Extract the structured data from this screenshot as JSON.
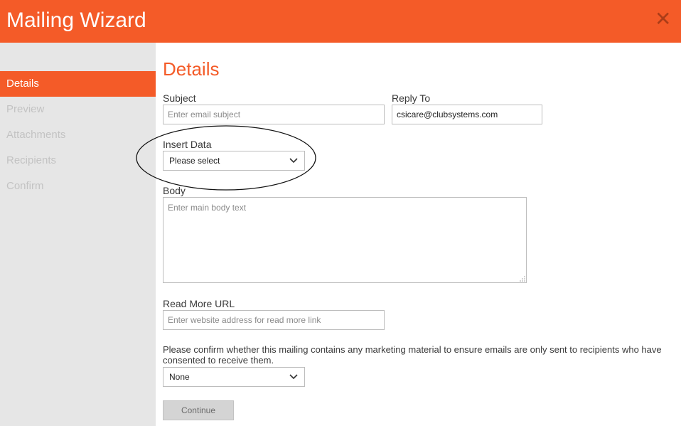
{
  "header": {
    "title": "Mailing Wizard",
    "close_icon": "close-icon"
  },
  "sidebar": {
    "items": [
      {
        "label": "Details",
        "active": true
      },
      {
        "label": "Preview",
        "active": false
      },
      {
        "label": "Attachments",
        "active": false
      },
      {
        "label": "Recipients",
        "active": false
      },
      {
        "label": "Confirm",
        "active": false
      }
    ]
  },
  "main": {
    "title": "Details",
    "subject": {
      "label": "Subject",
      "placeholder": "Enter email subject",
      "value": ""
    },
    "reply_to": {
      "label": "Reply To",
      "value": "csicare@clubsystems.com"
    },
    "insert_data": {
      "label": "Insert Data",
      "selected": "Please select"
    },
    "body": {
      "label": "Body",
      "placeholder": "Enter main body text",
      "value": ""
    },
    "read_more": {
      "label": "Read More URL",
      "placeholder": "Enter website address for read more link",
      "value": ""
    },
    "consent": {
      "text": "Please confirm whether this mailing contains any marketing material to ensure emails are only sent to recipients who have consented to receive them.",
      "selected": "None"
    },
    "continue_label": "Continue"
  },
  "colors": {
    "accent": "#f45b28",
    "sidebar_bg": "#e6e6e6",
    "nav_inactive": "#c3c3c3"
  }
}
